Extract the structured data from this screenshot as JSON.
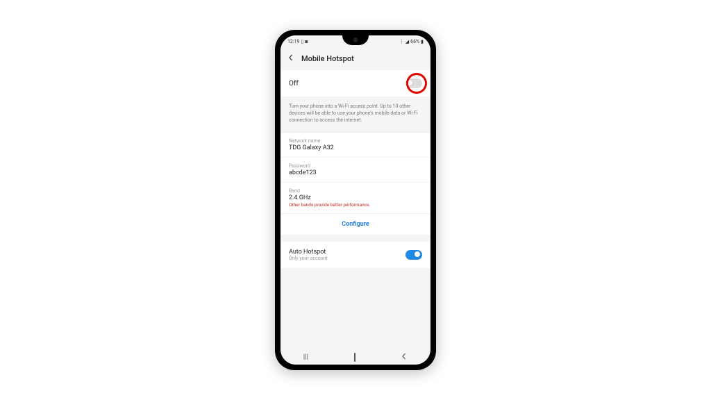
{
  "statusbar": {
    "time": "12:19",
    "battery": "66%"
  },
  "header": {
    "title": "Mobile Hotspot"
  },
  "toggle": {
    "label": "Off"
  },
  "description": "Turn your phone into a Wi-Fi access point. Up to 10 other devices will be able to use your phone's mobile data or Wi-Fi connection to access the internet.",
  "fields": {
    "network_name": {
      "label": "Network name",
      "value": "TDG Galaxy A32"
    },
    "password": {
      "label": "Password",
      "value": "abcde123"
    },
    "band": {
      "label": "Band",
      "value": "2.4 GHz",
      "hint": "Other bands provide better performance."
    }
  },
  "configure": "Configure",
  "auto_hotspot": {
    "title": "Auto Hotspot",
    "subtitle": "Only your account"
  }
}
